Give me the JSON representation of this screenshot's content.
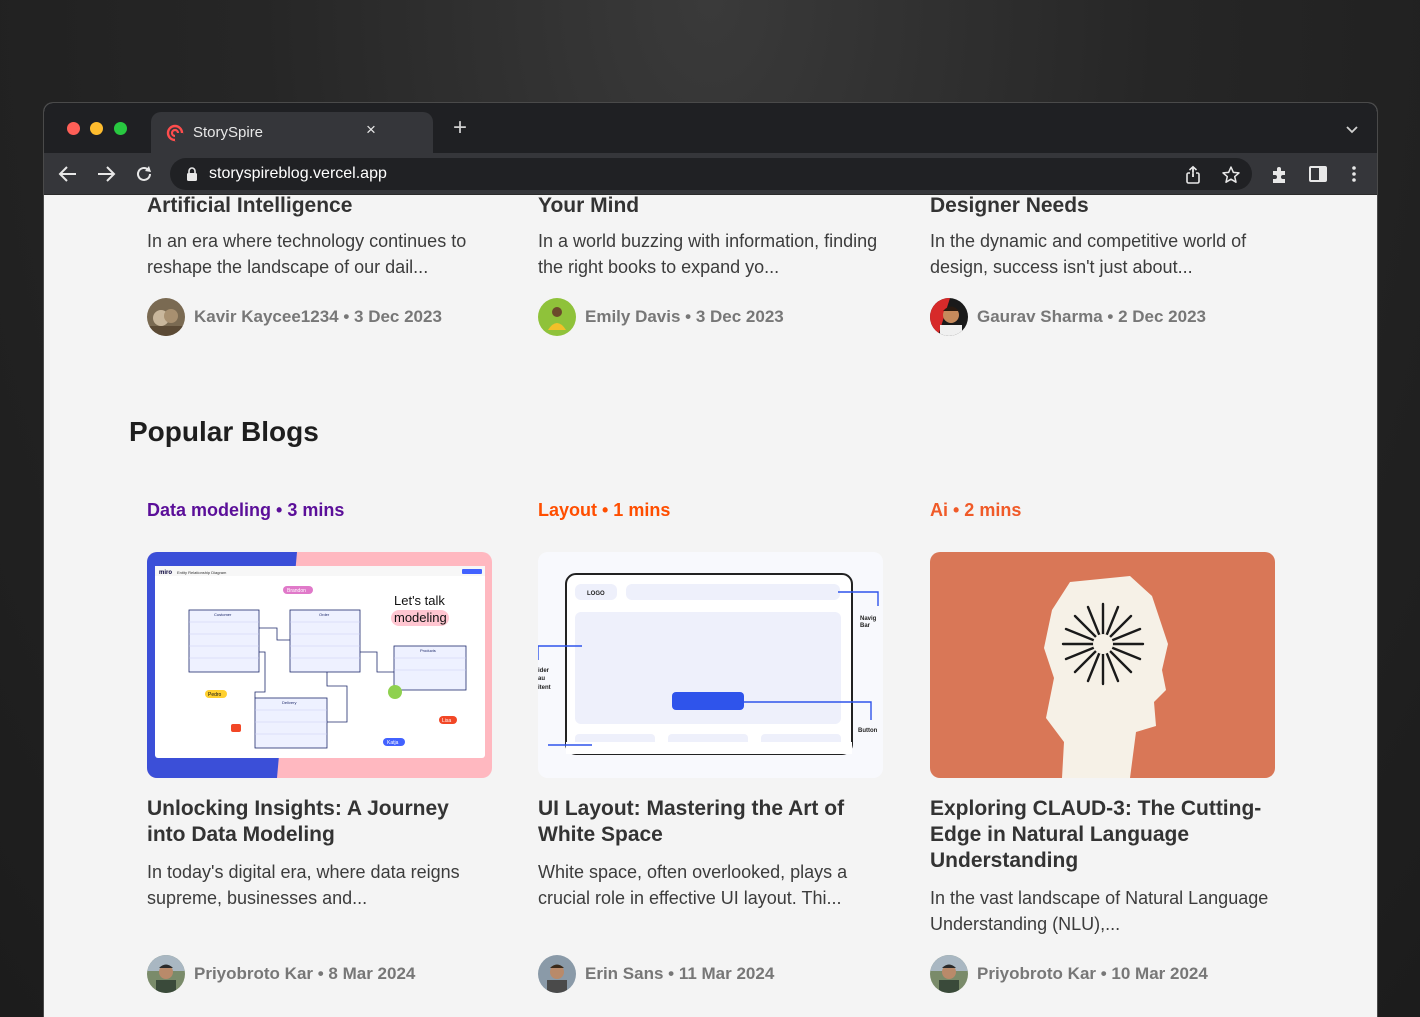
{
  "browser": {
    "tab_title": "StorySpire",
    "tab_close": "×",
    "new_tab": "+",
    "url": "storyspireblog.vercel.app"
  },
  "recent_cards": [
    {
      "title": "Artificial Intelligence",
      "excerpt": "In an era where technology continues to reshape the landscape of our dail...",
      "author": "Kavir Kaycee1234",
      "date": "3 Dec 2023",
      "meta": "Kavir Kaycee1234 • 3 Dec 2023"
    },
    {
      "title": "Your Mind",
      "excerpt": "In a world buzzing with information, finding the right books to expand yo...",
      "author": "Emily Davis",
      "date": "3 Dec 2023",
      "meta": "Emily Davis • 3 Dec 2023"
    },
    {
      "title": "Designer Needs",
      "excerpt": "In the dynamic and competitive world of design, success isn't just about...",
      "author": "Gaurav Sharma",
      "date": "2 Dec 2023",
      "meta": "Gaurav Sharma • 2 Dec 2023"
    }
  ],
  "popular": {
    "heading": "Popular Blogs",
    "cards": [
      {
        "tag": "Data modeling • 3 mins",
        "tag_color": "#5b0f99",
        "title": "Unlocking Insights: A Journey into Data Modeling",
        "excerpt": "In today's digital era, where data reigns supreme, businesses and...",
        "meta": "Priyobroto Kar • 8 Mar 2024",
        "thumb_text": [
          "miro",
          "Entity Relationship Diagram",
          "Let's talk",
          "modeling",
          "Brandon",
          "Customer",
          "Order",
          "Products",
          "Delivery",
          "Pedro",
          "Lisa",
          "Katja"
        ]
      },
      {
        "tag": "Layout • 1 mins",
        "tag_color": "#ff4e00",
        "title": "UI Layout: Mastering the Art of White Space",
        "excerpt": "White space, often overlooked, plays a crucial role in effective UI layout. Thi...",
        "meta": "Erin Sans • 11 Mar 2024",
        "thumb_text": [
          "LOGO",
          "Navig",
          "Bar",
          "ider",
          "au",
          "itent",
          "Button"
        ]
      },
      {
        "tag": "Ai • 2 mins",
        "tag_color": "#f05a28",
        "title": "Exploring CLAUD-3: The Cutting-Edge in Natural Language Understanding",
        "excerpt": "In the vast landscape of Natural Language Understanding (NLU),...",
        "meta": "Priyobroto Kar • 10 Mar 2024"
      }
    ]
  },
  "colors": {
    "thumb_ai_bg": "#d97757",
    "thumb_data_left": "#3b4fd8",
    "thumb_data_right": "#ffb8c0"
  }
}
